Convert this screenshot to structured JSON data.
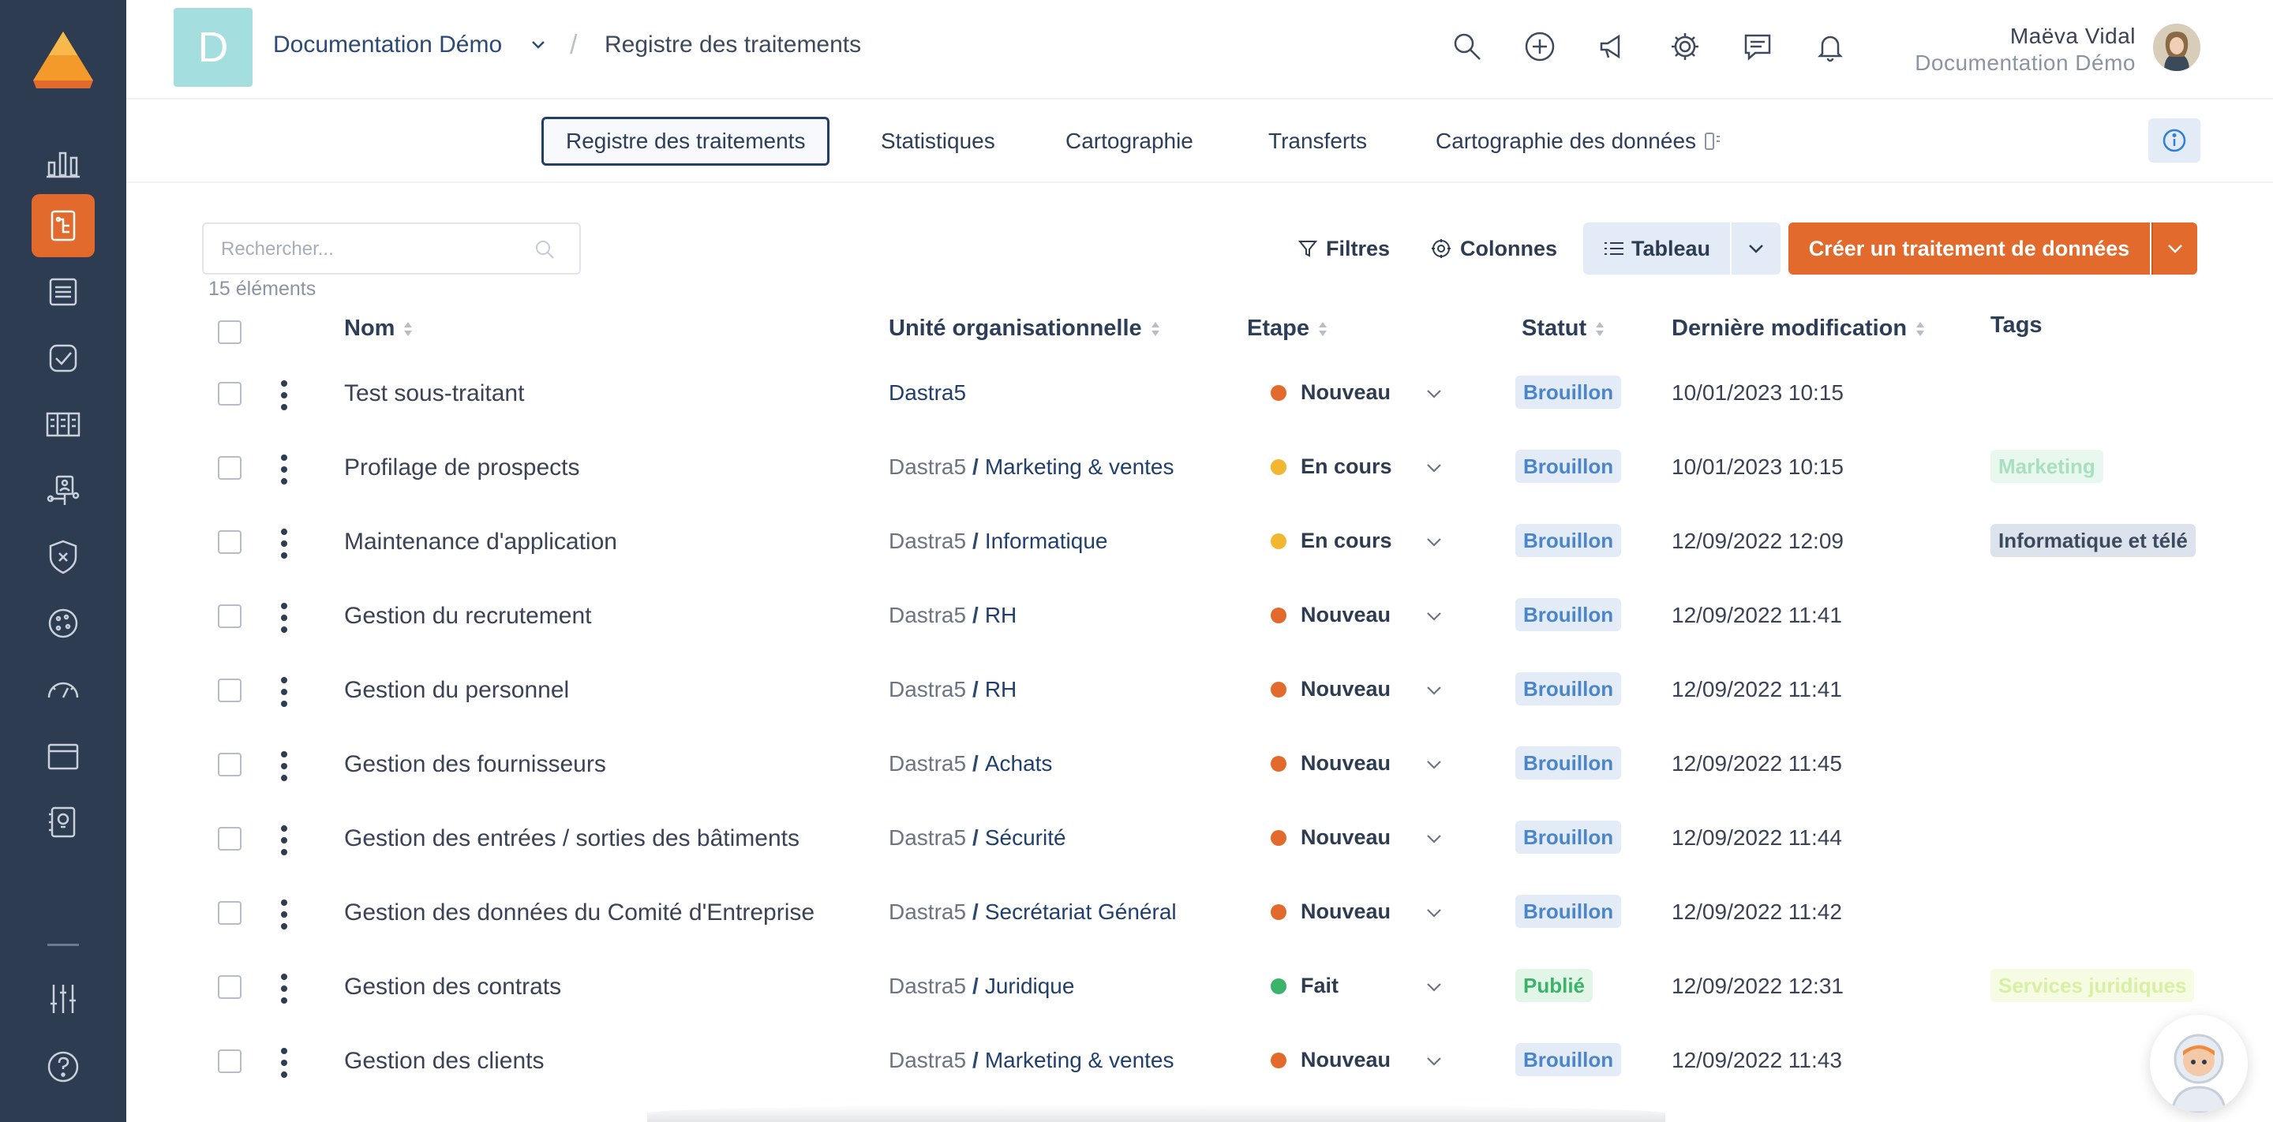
{
  "org": {
    "initial": "D",
    "name": "Documentation Démo"
  },
  "breadcrumb": {
    "separator": "/",
    "page": "Registre des traitements"
  },
  "user": {
    "name": "Maëva Vidal",
    "org": "Documentation Démo"
  },
  "tabs": [
    {
      "label": "Registre des traitements"
    },
    {
      "label": "Statistiques"
    },
    {
      "label": "Cartographie"
    },
    {
      "label": "Transferts"
    },
    {
      "label": "Cartographie des données"
    }
  ],
  "toolbar": {
    "search_placeholder": "Rechercher...",
    "count": "15 éléments",
    "filters": "Filtres",
    "columns": "Colonnes",
    "view": "Tableau",
    "create": "Créer un traitement de données"
  },
  "columns": {
    "name": "Nom",
    "unit": "Unité organisationnelle",
    "step": "Etape",
    "status": "Statut",
    "modified": "Dernière modification",
    "tags": "Tags"
  },
  "rows": [
    {
      "name": "Test sous-traitant",
      "unit_root": "Dastra5",
      "unit_child": "",
      "step": "Nouveau",
      "status": "Brouillon",
      "date": "10/01/2023 10:15",
      "tag": ""
    },
    {
      "name": "Profilage de prospects",
      "unit_root": "Dastra5",
      "unit_child": "Marketing & ventes",
      "step": "En cours",
      "status": "Brouillon",
      "date": "10/01/2023 10:15",
      "tag": "Marketing"
    },
    {
      "name": "Maintenance d'application",
      "unit_root": "Dastra5",
      "unit_child": "Informatique",
      "step": "En cours",
      "status": "Brouillon",
      "date": "12/09/2022 12:09",
      "tag": "Informatique et télé"
    },
    {
      "name": "Gestion du recrutement",
      "unit_root": "Dastra5",
      "unit_child": "RH",
      "step": "Nouveau",
      "status": "Brouillon",
      "date": "12/09/2022 11:41",
      "tag": ""
    },
    {
      "name": "Gestion du personnel",
      "unit_root": "Dastra5",
      "unit_child": "RH",
      "step": "Nouveau",
      "status": "Brouillon",
      "date": "12/09/2022 11:41",
      "tag": ""
    },
    {
      "name": "Gestion des fournisseurs",
      "unit_root": "Dastra5",
      "unit_child": "Achats",
      "step": "Nouveau",
      "status": "Brouillon",
      "date": "12/09/2022 11:45",
      "tag": ""
    },
    {
      "name": "Gestion des entrées / sorties des bâtiments",
      "unit_root": "Dastra5",
      "unit_child": "Sécurité",
      "step": "Nouveau",
      "status": "Brouillon",
      "date": "12/09/2022 11:44",
      "tag": ""
    },
    {
      "name": "Gestion des données du Comité d'Entreprise",
      "unit_root": "Dastra5",
      "unit_child": "Secrétariat Général",
      "step": "Nouveau",
      "status": "Brouillon",
      "date": "12/09/2022 11:42",
      "tag": ""
    },
    {
      "name": "Gestion des contrats",
      "unit_root": "Dastra5",
      "unit_child": "Juridique",
      "step": "Fait",
      "status": "Publié",
      "date": "12/09/2022 12:31",
      "tag": "Services juridiques"
    },
    {
      "name": "Gestion des clients",
      "unit_root": "Dastra5",
      "unit_child": "Marketing & ventes",
      "step": "Nouveau",
      "status": "Brouillon",
      "date": "12/09/2022 11:43",
      "tag": ""
    }
  ],
  "colors": {
    "sidebar": "#2e3c51",
    "accent": "#e26a2c",
    "step_new": "#e26a2c",
    "step_in_progress": "#f2b731",
    "step_done": "#3bb36a"
  },
  "sidebar_icons": [
    "dashboard-icon",
    "register-icon",
    "documents-icon",
    "checklist-icon",
    "catalog-icon",
    "organization-icon",
    "shield-icon",
    "cookie-icon",
    "gauge-icon",
    "folder-icon",
    "ideas-icon",
    "settings-sliders-icon",
    "help-icon"
  ]
}
